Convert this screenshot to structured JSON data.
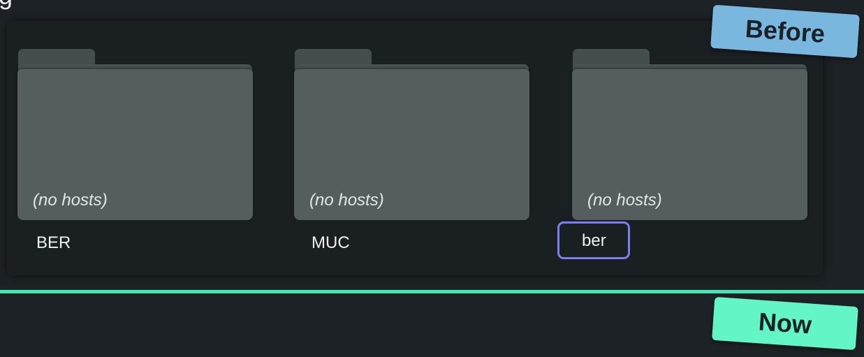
{
  "folders": [
    {
      "note": "(no hosts)",
      "label": "BER"
    },
    {
      "note": "(no hosts)",
      "label": "MUC"
    },
    {
      "note": "(no hosts)",
      "label": "ber"
    }
  ],
  "stamps": {
    "before": "Before",
    "now": "Now"
  },
  "colors": {
    "background": "#1d2226",
    "folder": "#555d5e",
    "edit_focus_border": "#7b7ff2",
    "divider": "#49e6b4",
    "before_stamp": "#7ab7de",
    "now_stamp": "#63f5c5"
  }
}
